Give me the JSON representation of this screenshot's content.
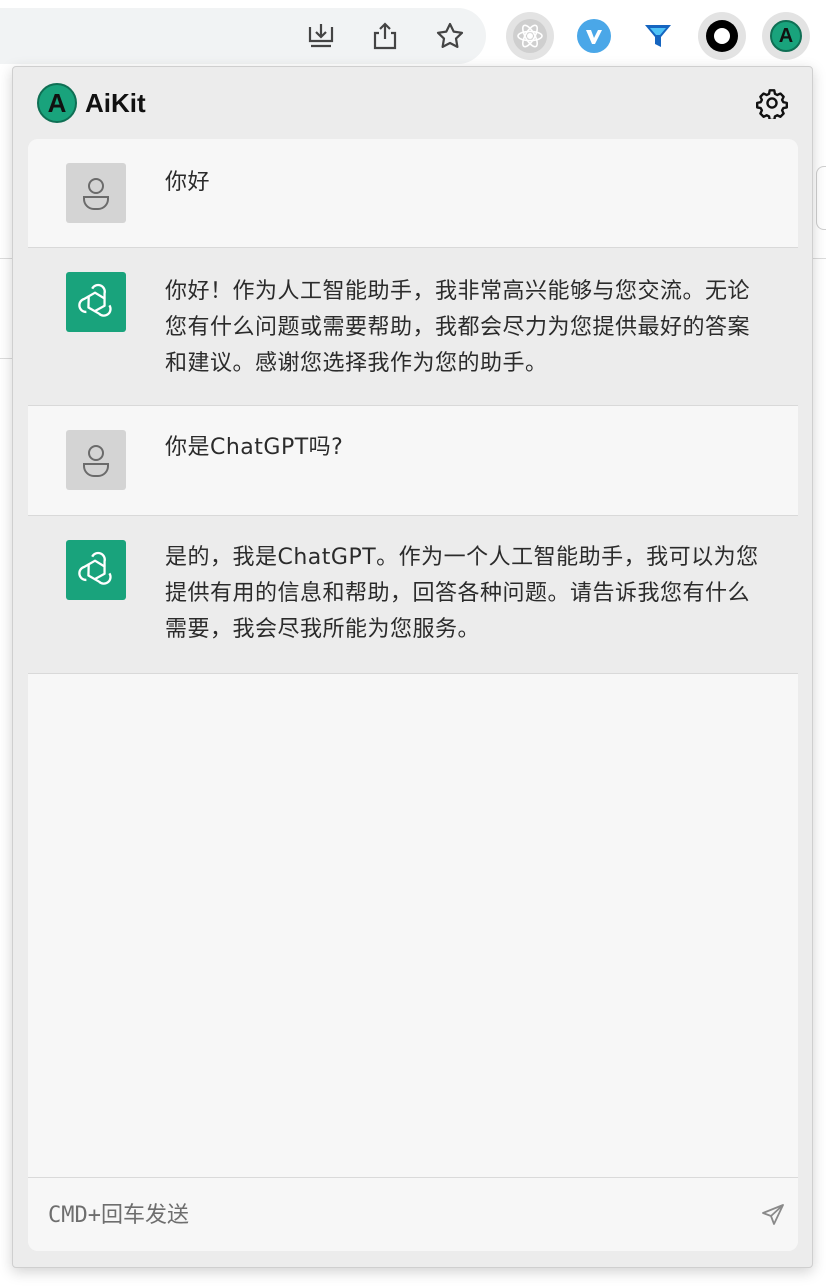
{
  "toolbar": {
    "icons": [
      "download-icon",
      "share-icon",
      "bookmark-star-icon",
      "react-devtools-icon",
      "vue-devtools-icon",
      "filter-extension-icon",
      "circle-extension-icon",
      "aikit-extension-icon"
    ]
  },
  "app": {
    "title": "AiKit",
    "logo_letter": "A",
    "accent_color": "#19a37c"
  },
  "messages": [
    {
      "role": "user",
      "text": "你好"
    },
    {
      "role": "assistant",
      "text": "你好！作为人工智能助手，我非常高兴能够与您交流。无论您有什么问题或需要帮助，我都会尽力为您提供最好的答案和建议。感谢您选择我作为您的助手。"
    },
    {
      "role": "user",
      "text": "你是ChatGPT吗?"
    },
    {
      "role": "assistant",
      "text": "是的，我是ChatGPT。作为一个人工智能助手，我可以为您提供有用的信息和帮助，回答各种问题。请告诉我您有什么需要，我会尽我所能为您服务。"
    }
  ],
  "composer": {
    "placeholder": "CMD+回车发送"
  }
}
